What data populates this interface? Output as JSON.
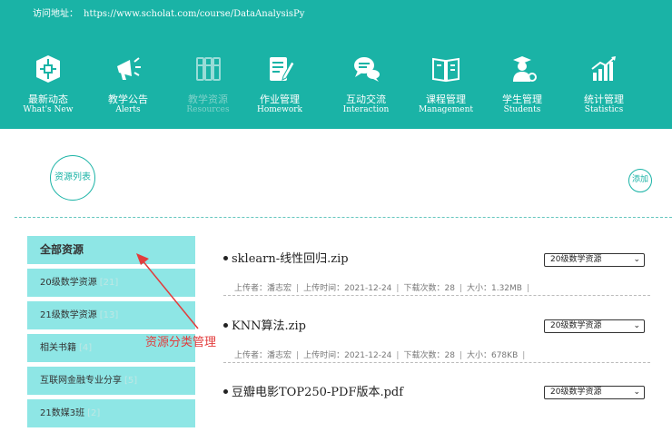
{
  "header": {
    "address_label": "访问地址：",
    "address_url": "https://www.scholat.com/course/DataAnalysisPy",
    "nav": [
      {
        "zh": "最新动态",
        "en": "What's New",
        "icon": "news-icon"
      },
      {
        "zh": "教学公告",
        "en": "Alerts",
        "icon": "megaphone-icon"
      },
      {
        "zh": "教学资源",
        "en": "Resources",
        "icon": "books-icon"
      },
      {
        "zh": "作业管理",
        "en": "Homework",
        "icon": "homework-icon"
      },
      {
        "zh": "互动交流",
        "en": "Interaction",
        "icon": "chat-icon"
      },
      {
        "zh": "课程管理",
        "en": "Management",
        "icon": "book-open-icon"
      },
      {
        "zh": "学生管理",
        "en": "Students",
        "icon": "student-icon"
      },
      {
        "zh": "统计管理",
        "en": "Statistics",
        "icon": "chart-icon"
      }
    ]
  },
  "toolbar": {
    "list_label": "资源列表",
    "add_label": "添加"
  },
  "sidebar": {
    "items": [
      {
        "label": "全部资源",
        "count": ""
      },
      {
        "label": "20级数学资源",
        "count": "[21]"
      },
      {
        "label": "21级数学资源",
        "count": "[13]"
      },
      {
        "label": "相关书籍",
        "count": "[4]"
      },
      {
        "label": "互联网金融专业分享",
        "count": "[5]"
      },
      {
        "label": "21数媒3班",
        "count": "[2]"
      }
    ]
  },
  "annotation": {
    "text": "资源分类管理"
  },
  "files": [
    {
      "name": "sklearn-线性回归.zip",
      "uploader_label": "上传者：",
      "uploader": "潘志宏",
      "time_label": "上传时间：",
      "time": "2021-12-24",
      "downloads_label": "下载次数：",
      "downloads": "28",
      "size_label": "大小：",
      "size": "1.32MB",
      "category": "20级数学资源"
    },
    {
      "name": "KNN算法.zip",
      "uploader_label": "上传者：",
      "uploader": "潘志宏",
      "time_label": "上传时间：",
      "time": "2021-12-24",
      "downloads_label": "下载次数：",
      "downloads": "28",
      "size_label": "大小：",
      "size": "678KB",
      "category": "20级数学资源"
    },
    {
      "name": "豆瓣电影TOP250-PDF版本.pdf",
      "category": "20级数学资源"
    }
  ],
  "colors": {
    "teal": "#1ab3a6",
    "sidebar_bg": "#8ee6e5",
    "annotation_red": "#e23c3c"
  }
}
